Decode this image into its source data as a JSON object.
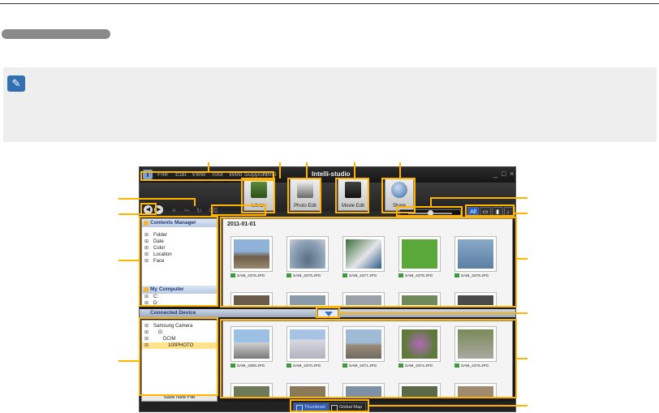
{
  "app": {
    "title": "Intelli-studio"
  },
  "menu": [
    "File",
    "Edit",
    "View",
    "Tool",
    "Web Support",
    "Help"
  ],
  "mode_buttons": [
    {
      "label": "Library",
      "icon": "library-icon"
    },
    {
      "label": "Photo Edit",
      "icon": "photo-edit-icon"
    },
    {
      "label": "Movie Edit",
      "icon": "movie-edit-icon"
    },
    {
      "label": "Share",
      "icon": "share-globe-icon"
    }
  ],
  "filters": [
    "All",
    "photo-icon",
    "video-icon",
    "voice-icon"
  ],
  "contents_manager": {
    "title": "Contents Manager",
    "items": [
      "Folder",
      "Date",
      "Color",
      "Location",
      "Face"
    ]
  },
  "my_computer": {
    "title": "My Computer",
    "drives": [
      "C:",
      "D:"
    ]
  },
  "connected_device": {
    "title": "Connected Device",
    "tree": [
      "Samsung Camera",
      "G:",
      "DCIM",
      "100PHOTO"
    ],
    "save_label": "Save New File"
  },
  "library": {
    "date_group": "2011-01-01",
    "files_top": [
      "SAM_4375.JPG",
      "SAM_4376.JPG",
      "SAM_4377.JPG",
      "SAM_4378.JPG",
      "SAM_4379.JPG"
    ],
    "files_bottom": [
      "SAM_4369.JPG",
      "SAM_4370.JPG",
      "SAM_4371.JPG",
      "SAM_4374.JPG",
      "SAM_4375.JPG"
    ]
  },
  "view_tabs": [
    "Thumbnail",
    "Global Map"
  ],
  "colors": {
    "accent": "#ffb400",
    "selected": "#2d5cb8",
    "note_icon": "#2f6fb2"
  }
}
